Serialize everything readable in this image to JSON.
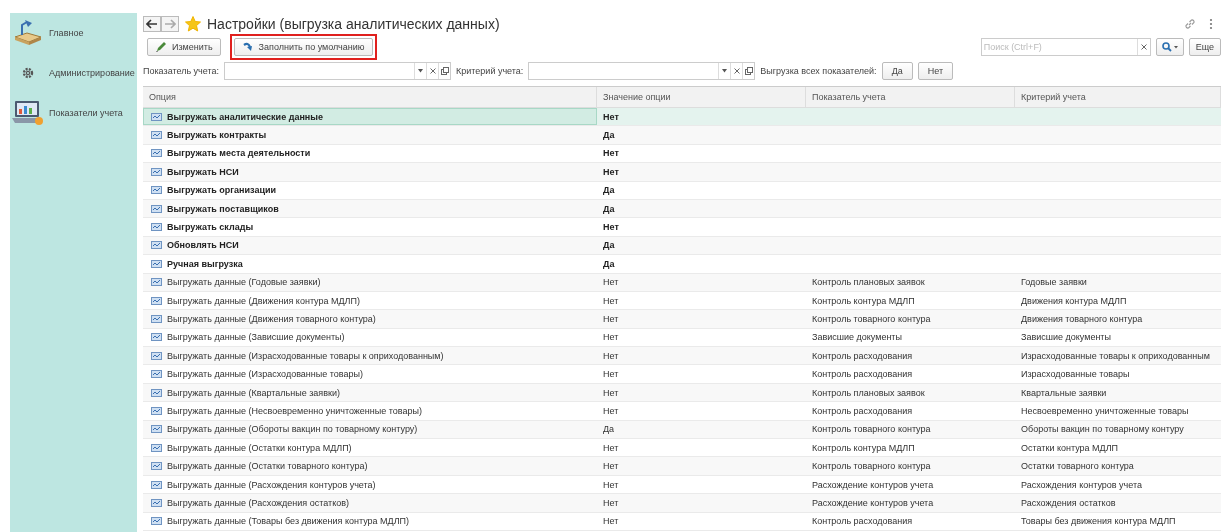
{
  "sidebar": {
    "items": [
      {
        "label": "Главное"
      },
      {
        "label": "Администрирование"
      },
      {
        "label": "Показатели учета"
      }
    ]
  },
  "window": {
    "title": "Настройки (выгрузка аналитических данных)",
    "favorite": true
  },
  "toolbar": {
    "buttons": [
      {
        "label": "Изменить",
        "highlighted": false
      },
      {
        "label": "Заполнить по умолчанию",
        "highlighted": true
      }
    ],
    "search": {
      "placeholder": "Поиск (Ctrl+F)"
    },
    "more": "Еще"
  },
  "filters": {
    "indicator_label": "Показатель учета:",
    "criterion_label": "Критерий учета:",
    "export_all_label": "Выгрузка всех показателей:",
    "yes": "Да",
    "no": "Нет"
  },
  "table": {
    "columns": [
      "Опция",
      "Значение опции",
      "Показатель учета",
      "Критерий учета"
    ],
    "rows": [
      {
        "option": "Выгружать аналитические данные",
        "value": "Нет",
        "indicator": "",
        "criterion": "",
        "bold": true,
        "selected": true
      },
      {
        "option": "Выгружать контракты",
        "value": "Да",
        "indicator": "",
        "criterion": "",
        "bold": true,
        "selected": false
      },
      {
        "option": "Выгружать места деятельности",
        "value": "Нет",
        "indicator": "",
        "criterion": "",
        "bold": true,
        "selected": false
      },
      {
        "option": "Выгружать НСИ",
        "value": "Нет",
        "indicator": "",
        "criterion": "",
        "bold": true,
        "selected": false
      },
      {
        "option": "Выгружать организации",
        "value": "Да",
        "indicator": "",
        "criterion": "",
        "bold": true,
        "selected": false
      },
      {
        "option": "Выгружать поставщиков",
        "value": "Да",
        "indicator": "",
        "criterion": "",
        "bold": true,
        "selected": false
      },
      {
        "option": "Выгружать склады",
        "value": "Нет",
        "indicator": "",
        "criterion": "",
        "bold": true,
        "selected": false
      },
      {
        "option": "Обновлять НСИ",
        "value": "Да",
        "indicator": "",
        "criterion": "",
        "bold": true,
        "selected": false
      },
      {
        "option": "Ручная выгрузка",
        "value": "Да",
        "indicator": "",
        "criterion": "",
        "bold": true,
        "selected": false
      },
      {
        "option": "Выгружать данные (Годовые заявки)",
        "value": "Нет",
        "indicator": "Контроль плановых заявок",
        "criterion": "Годовые заявки",
        "bold": false,
        "selected": false
      },
      {
        "option": "Выгружать данные (Движения контура МДЛП)",
        "value": "Нет",
        "indicator": "Контроль контура МДЛП",
        "criterion": "Движения контура МДЛП",
        "bold": false,
        "selected": false
      },
      {
        "option": "Выгружать данные (Движения товарного контура)",
        "value": "Нет",
        "indicator": "Контроль товарного контура",
        "criterion": "Движения товарного контура",
        "bold": false,
        "selected": false
      },
      {
        "option": "Выгружать данные (Зависшие документы)",
        "value": "Нет",
        "indicator": "Зависшие документы",
        "criterion": "Зависшие документы",
        "bold": false,
        "selected": false
      },
      {
        "option": "Выгружать данные (Израсходованные товары к оприходованным)",
        "value": "Нет",
        "indicator": "Контроль расходования",
        "criterion": "Израсходованные товары к оприходованным",
        "bold": false,
        "selected": false
      },
      {
        "option": "Выгружать данные (Израсходованные товары)",
        "value": "Нет",
        "indicator": "Контроль расходования",
        "criterion": "Израсходованные товары",
        "bold": false,
        "selected": false
      },
      {
        "option": "Выгружать данные (Квартальные заявки)",
        "value": "Нет",
        "indicator": "Контроль плановых заявок",
        "criterion": "Квартальные заявки",
        "bold": false,
        "selected": false
      },
      {
        "option": "Выгружать данные (Несвоевременно уничтоженные товары)",
        "value": "Нет",
        "indicator": "Контроль расходования",
        "criterion": "Несвоевременно уничтоженные товары",
        "bold": false,
        "selected": false
      },
      {
        "option": "Выгружать данные (Обороты вакцин по товарному контуру)",
        "value": "Да",
        "indicator": "Контроль товарного контура",
        "criterion": "Обороты вакцин по товарному контуру",
        "bold": false,
        "selected": false
      },
      {
        "option": "Выгружать данные (Остатки контура МДЛП)",
        "value": "Нет",
        "indicator": "Контроль контура МДЛП",
        "criterion": "Остатки контура МДЛП",
        "bold": false,
        "selected": false
      },
      {
        "option": "Выгружать данные (Остатки товарного контура)",
        "value": "Нет",
        "indicator": "Контроль товарного контура",
        "criterion": "Остатки товарного контура",
        "bold": false,
        "selected": false
      },
      {
        "option": "Выгружать данные (Расхождения контуров учета)",
        "value": "Нет",
        "indicator": "Расхождение контуров учета",
        "criterion": "Расхождения контуров учета",
        "bold": false,
        "selected": false
      },
      {
        "option": "Выгружать данные (Расхождения остатков)",
        "value": "Нет",
        "indicator": "Расхождение контуров учета",
        "criterion": "Расхождения остатков",
        "bold": false,
        "selected": false
      },
      {
        "option": "Выгружать данные (Товары без движения контура МДЛП)",
        "value": "Нет",
        "indicator": "Контроль расходования",
        "criterion": "Товары без движения контура МДЛП",
        "bold": false,
        "selected": false
      }
    ]
  }
}
